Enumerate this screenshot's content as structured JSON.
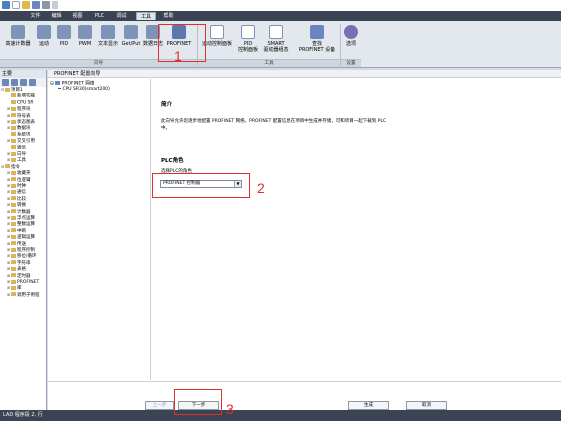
{
  "menu": {
    "items": [
      "文件",
      "编辑",
      "视图",
      "PLC",
      "调试",
      "工具",
      "帮助"
    ],
    "active": "工具"
  },
  "ribbon": {
    "buttons": [
      {
        "label": "高速计数器"
      },
      {
        "label": "运动"
      },
      {
        "label": "PID"
      },
      {
        "label": "PWM"
      },
      {
        "label": "文本显示"
      },
      {
        "label": "Get/Put"
      },
      {
        "label": "数据日志"
      },
      {
        "label": "PROFINET"
      },
      {
        "label": "运动控制面板"
      },
      {
        "label": "PID"
      },
      {
        "label": "SMART"
      },
      {
        "label": "查找"
      },
      {
        "label": "选项"
      }
    ],
    "second_lines": {
      "pid2": "控制面板",
      "smart": "驱动器组态",
      "find": "PROFINET 设备"
    },
    "groups": [
      "向导",
      "工具",
      "设置"
    ]
  },
  "left_panel": {
    "title": "主要",
    "tree": [
      {
        "label": "项目1",
        "level": 0,
        "expander": "⊟"
      },
      {
        "label": "新增功能",
        "level": 1,
        "expander": ""
      },
      {
        "label": "CPU SR",
        "level": 1,
        "expander": ""
      },
      {
        "label": "程序块",
        "level": 1,
        "expander": "⊞"
      },
      {
        "label": "符号表",
        "level": 1,
        "expander": "⊞"
      },
      {
        "label": "状态图表",
        "level": 1,
        "expander": "⊞"
      },
      {
        "label": "数据块",
        "level": 1,
        "expander": "⊞"
      },
      {
        "label": "系统块",
        "level": 1,
        "expander": ""
      },
      {
        "label": "交叉引用",
        "level": 1,
        "expander": "⊞"
      },
      {
        "label": "通信",
        "level": 1,
        "expander": ""
      },
      {
        "label": "向导",
        "level": 1,
        "expander": "⊞"
      },
      {
        "label": "工具",
        "level": 1,
        "expander": "⊞"
      },
      {
        "label": "指令",
        "level": 0,
        "expander": "⊟"
      },
      {
        "label": "收藏夹",
        "level": 1,
        "expander": "⊞"
      },
      {
        "label": "位逻辑",
        "level": 1,
        "expander": "⊞"
      },
      {
        "label": "时钟",
        "level": 1,
        "expander": "⊞"
      },
      {
        "label": "通信",
        "level": 1,
        "expander": "⊞"
      },
      {
        "label": "比较",
        "level": 1,
        "expander": "⊞"
      },
      {
        "label": "转换",
        "level": 1,
        "expander": "⊞"
      },
      {
        "label": "计数器",
        "level": 1,
        "expander": "⊞"
      },
      {
        "label": "浮点运算",
        "level": 1,
        "expander": "⊞"
      },
      {
        "label": "整数运算",
        "level": 1,
        "expander": "⊞"
      },
      {
        "label": "中断",
        "level": 1,
        "expander": "⊞"
      },
      {
        "label": "逻辑运算",
        "level": 1,
        "expander": "⊞"
      },
      {
        "label": "传送",
        "level": 1,
        "expander": "⊞"
      },
      {
        "label": "程序控制",
        "level": 1,
        "expander": "⊞"
      },
      {
        "label": "移位/循环",
        "level": 1,
        "expander": "⊞"
      },
      {
        "label": "字符串",
        "level": 1,
        "expander": "⊞"
      },
      {
        "label": "表格",
        "level": 1,
        "expander": "⊞"
      },
      {
        "label": "定时器",
        "level": 1,
        "expander": "⊞"
      },
      {
        "label": "PROFINET",
        "level": 1,
        "expander": "⊞"
      },
      {
        "label": "库",
        "level": 1,
        "expander": "⊞"
      },
      {
        "label": "调用子例程",
        "level": 1,
        "expander": "⊞"
      }
    ]
  },
  "wizard": {
    "title": "PROFINET 配置向导",
    "nav": [
      {
        "label": "PROFINET 网络",
        "expander": "⊟"
      },
      {
        "label": "CPU SR30(smart200)",
        "expander": ""
      }
    ],
    "section_intro": "简介",
    "description_line1": "此向导允许您逐步地配置 PROFINET 网络。PROFINET 配置信息在项目中生成并存储，可和项目一起下载到 PLC",
    "description_line2": "中。",
    "section_role": "PLC角色",
    "role_label": "选择PLC的角色",
    "role_value": "PROFINET 控制器",
    "buttons": {
      "prev": "上一步",
      "next": "下一步",
      "generate": "生成",
      "cancel": "取消"
    }
  },
  "status_bar": "LAD 程序段 2, 行",
  "annotations": [
    "1",
    "2",
    "3"
  ],
  "colors": {
    "menu_bg": "#3b4453",
    "annotation": "#e0302c",
    "ribbon_bg": "#e3e7ee"
  }
}
